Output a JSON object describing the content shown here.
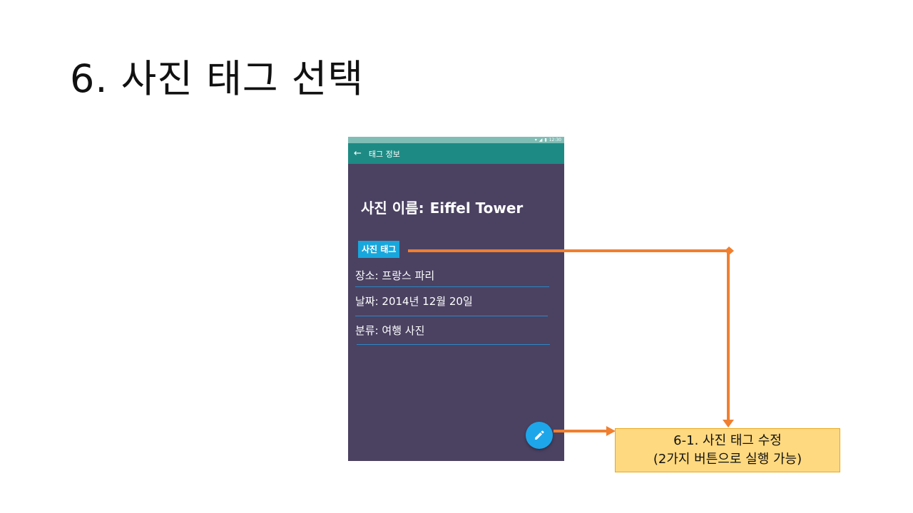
{
  "slide": {
    "title": "6. 사진 태그 선택"
  },
  "phone": {
    "status_time": "12:30",
    "appbar": {
      "back_icon": "arrow-left-icon",
      "title": "태그 정보"
    },
    "photo_name_label": "사진 이름:",
    "photo_name_value": "Eiffel Tower",
    "tag_button_label": "사진 태그",
    "fields": [
      {
        "text": "장소: 프랑스 파리"
      },
      {
        "text": "날짜: 2014년 12월 20일"
      },
      {
        "text": "분류: 여행 사진"
      }
    ],
    "fab_icon": "pencil-icon"
  },
  "callout": {
    "line1": "6-1. 사진 태그 수정",
    "line2": "(2가지 버튼으로 실행 가능)"
  },
  "colors": {
    "arrow": "#f07f2f",
    "appbar": "#1e8a84",
    "content_bg": "#4b4262",
    "accent": "#17a7dc",
    "callout_bg": "#ffd97f"
  }
}
